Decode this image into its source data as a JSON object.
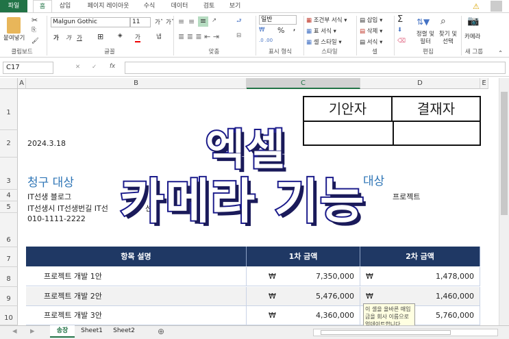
{
  "ribbon_tabs": [
    "파일",
    "홈",
    "삽입",
    "페이지 레이아웃",
    "수식",
    "데이터",
    "검토",
    "보기"
  ],
  "active_tab": "홈",
  "accent": "#217346",
  "ribbon": {
    "paste": "붙여넣기",
    "font_name": "Malgun Gothic",
    "font_size": "11",
    "number_format": "일반",
    "percent": "%",
    "comma": ",",
    "conditional": "조건부 서식",
    "table_format": "표 서식",
    "cell_style": "셀 스타일",
    "insert": "삽입",
    "delete": "삭제",
    "format": "서식",
    "sigma": "Σ",
    "sort": "정렬 및 필터",
    "find": "찾기 및 선택",
    "camera": "카메라",
    "groups": [
      "클립보드",
      "글꼴",
      "맞춤",
      "표시 형식",
      "스타일",
      "셀",
      "편집",
      "새 그룹"
    ]
  },
  "formula_bar": {
    "name_box": "C17",
    "fx": "fx",
    "value": ""
  },
  "columns": [
    "A",
    "B",
    "C",
    "D",
    "E"
  ],
  "rows": [
    "1",
    "2",
    "3",
    "4",
    "5",
    "6",
    "7",
    "8",
    "9",
    "10"
  ],
  "sheet": {
    "approval": [
      "기안자",
      "결재자"
    ],
    "date": "2024.3.18",
    "bill_to": "청구 대상",
    "bill_to_right": "대상",
    "line4": "IT선생 블로그",
    "line4_right": "프로젝트",
    "line5": "IT선생시 IT선생번길 IT선",
    "line5_tail": "선",
    "phone": "010-1111-2222",
    "table_headers": [
      "항목 설명",
      "1차 금액",
      "2차 금액"
    ],
    "currency": "₩",
    "table_rows": [
      {
        "item": "프로젝트 개발 1안",
        "amount1": "7,350,000",
        "amount2": "1,478,000"
      },
      {
        "item": "프로젝트 개발 2안",
        "amount1": "5,476,000",
        "amount2": "1,460,000"
      },
      {
        "item": "프로젝트 개발 3안",
        "amount1": "4,360,000",
        "amount2": "5,760,000"
      }
    ],
    "tooltip": "이 셀을 올바른 매입금을 회사 이름으로 업데이트합니다."
  },
  "overlay": {
    "line1": "엑셀",
    "line2": "카메라 기능"
  },
  "sheet_tabs": [
    "송장",
    "Sheet1",
    "Sheet2"
  ],
  "active_sheet": "송장"
}
